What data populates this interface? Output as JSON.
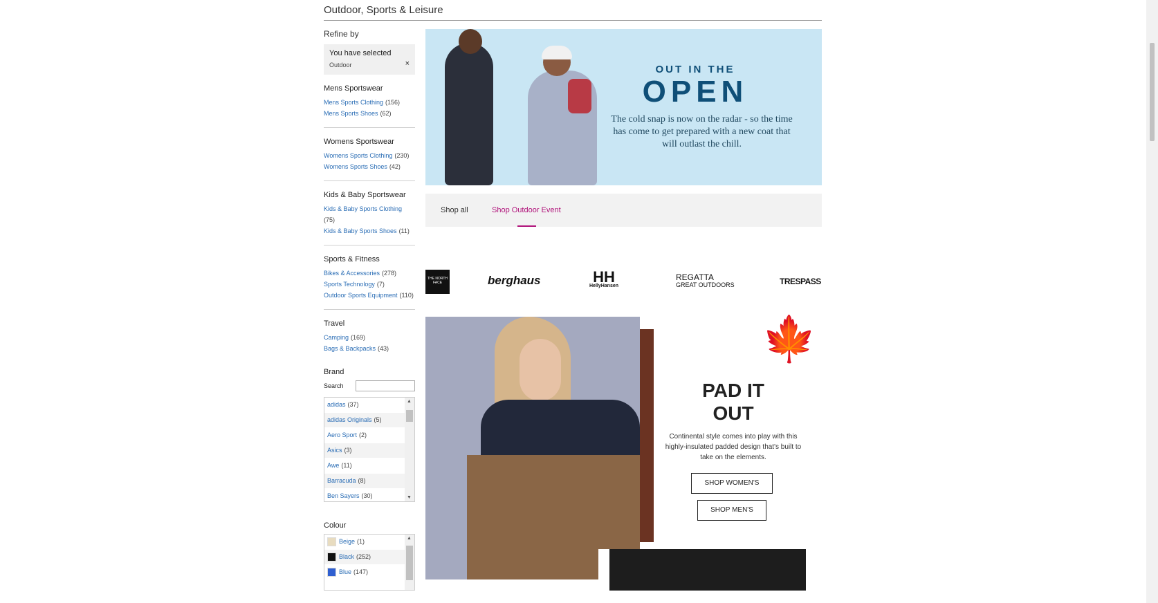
{
  "page": {
    "title": "Outdoor, Sports & Leisure"
  },
  "sidebar": {
    "refine_label": "Refine by",
    "selected": {
      "heading": "You have selected",
      "value": "Outdoor",
      "remove": "×"
    },
    "facets": [
      {
        "heading": "Mens Sportswear",
        "links": [
          {
            "label": "Mens Sports Clothing",
            "count": "(156)"
          },
          {
            "label": "Mens Sports Shoes",
            "count": "(62)"
          }
        ]
      },
      {
        "heading": "Womens Sportswear",
        "links": [
          {
            "label": "Womens Sports Clothing",
            "count": "(230)"
          },
          {
            "label": "Womens Sports Shoes",
            "count": "(42)"
          }
        ]
      },
      {
        "heading": "Kids & Baby Sportswear",
        "links": [
          {
            "label": "Kids & Baby Sports Clothing",
            "count": "(75)"
          },
          {
            "label": "Kids & Baby Sports Shoes",
            "count": "(11)"
          }
        ]
      },
      {
        "heading": "Sports & Fitness",
        "links": [
          {
            "label": "Bikes & Accessories",
            "count": "(278)"
          },
          {
            "label": "Sports Technology",
            "count": "(7)"
          },
          {
            "label": "Outdoor Sports Equipment",
            "count": "(110)"
          }
        ]
      },
      {
        "heading": "Travel",
        "links": [
          {
            "label": "Camping",
            "count": "(169)"
          },
          {
            "label": "Bags & Backpacks",
            "count": "(43)"
          }
        ]
      }
    ],
    "brand": {
      "heading": "Brand",
      "search_label": "Search",
      "items": [
        {
          "label": "adidas",
          "count": "(37)"
        },
        {
          "label": "adidas Originals",
          "count": "(5)"
        },
        {
          "label": "Aero Sport",
          "count": "(2)"
        },
        {
          "label": "Asics",
          "count": "(3)"
        },
        {
          "label": "Awe",
          "count": "(11)"
        },
        {
          "label": "Barracuda",
          "count": "(8)"
        },
        {
          "label": "Ben Sayers",
          "count": "(30)"
        }
      ]
    },
    "colour": {
      "heading": "Colour",
      "items": [
        {
          "label": "Beige",
          "count": "(1)",
          "swatch": "#e8dcc0"
        },
        {
          "label": "Black",
          "count": "(252)",
          "swatch": "#111111"
        },
        {
          "label": "Blue",
          "count": "(147)",
          "swatch": "#2f5fd0"
        }
      ]
    }
  },
  "hero": {
    "kicker": "OUT IN THE",
    "headline": "OPEN",
    "copy": "The cold snap is now on the radar - so the time has come to get prepared with a new coat that will outlast the chill."
  },
  "tabs": {
    "shop_all": "Shop all",
    "shop_event": "Shop Outdoor Event"
  },
  "brand_logos": {
    "tnf": "THE NORTH FACE",
    "berghaus": "berghaus",
    "hh_top": "HH",
    "hh_bottom": "HellyHansen",
    "regatta_top": "REGATTA",
    "regatta_bottom": "GREAT OUTDOORS",
    "trespass": "TRESPASS"
  },
  "promo": {
    "headline_line1": "PAD IT",
    "headline_line2": "OUT",
    "copy": "Continental style comes into play with this highly-insulated padded design that's built to take on the elements.",
    "shop_womens": "SHOP WOMEN'S",
    "shop_mens": "SHOP MEN'S"
  },
  "colors": {
    "link": "#2a6db5",
    "accent": "#b0127a",
    "hero_bg": "#c9e6f4",
    "hero_text": "#0f4f78"
  }
}
